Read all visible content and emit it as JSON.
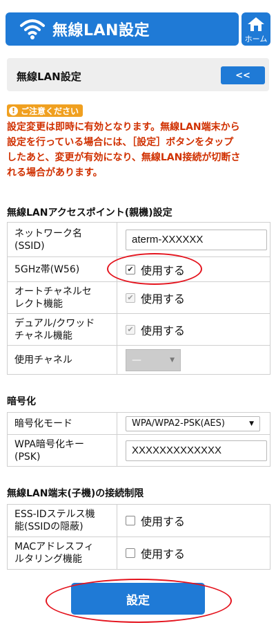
{
  "header": {
    "title": "無線LAN設定",
    "home_label": "ホーム"
  },
  "subbar": {
    "title": "無線LAN設定",
    "back_label": "<<"
  },
  "caution": {
    "badge": "ご注意ください",
    "lines": [
      "設定変更は即時に有効となります。無線LAN端末から",
      "設定を行っている場合には、［設定］ボタンをタップ",
      "したあと、変更が有効になり、無線LAN接続が切断さ",
      "れる場合があります。"
    ]
  },
  "section_ap": {
    "title": "無線LANアクセスポイント(親機)設定",
    "ssid_label": [
      "ネットワーク名",
      "(SSID)"
    ],
    "ssid_value": "aterm-XXXXXX",
    "band_label": "5GHz帯(W56)",
    "band_value": "使用する",
    "auto_label": [
      "オートチャネルセ",
      "レクト機能"
    ],
    "auto_value": "使用する",
    "dual_label": [
      "デュアル/クワッド",
      "チャネル機能"
    ],
    "dual_value": "使用する",
    "channel_label": "使用チャネル",
    "channel_value": "—"
  },
  "section_enc": {
    "title": "暗号化",
    "mode_label": "暗号化モード",
    "mode_value": "WPA/WPA2-PSK(AES)",
    "key_label": [
      "WPA暗号化キー",
      "(PSK)"
    ],
    "key_value": "XXXXXXXXXXXXX"
  },
  "section_limit": {
    "title": "無線LAN端末(子機)の接続制限",
    "stealth_label": [
      "ESS-IDステルス機",
      "能(SSIDの隠蔽)"
    ],
    "stealth_value": "使用する",
    "mac_label": [
      "MACアドレスフィ",
      "ルタリング機能"
    ],
    "mac_value": "使用する"
  },
  "submit_label": "設定",
  "colors": {
    "accent": "#1f7ad6",
    "warning_text": "#d03000",
    "caution_badge": "#f0a020",
    "annotation": "#e4141e"
  },
  "icons": {
    "header": "wifi-icon",
    "home": "home-icon",
    "caution": "exclamation-icon"
  }
}
